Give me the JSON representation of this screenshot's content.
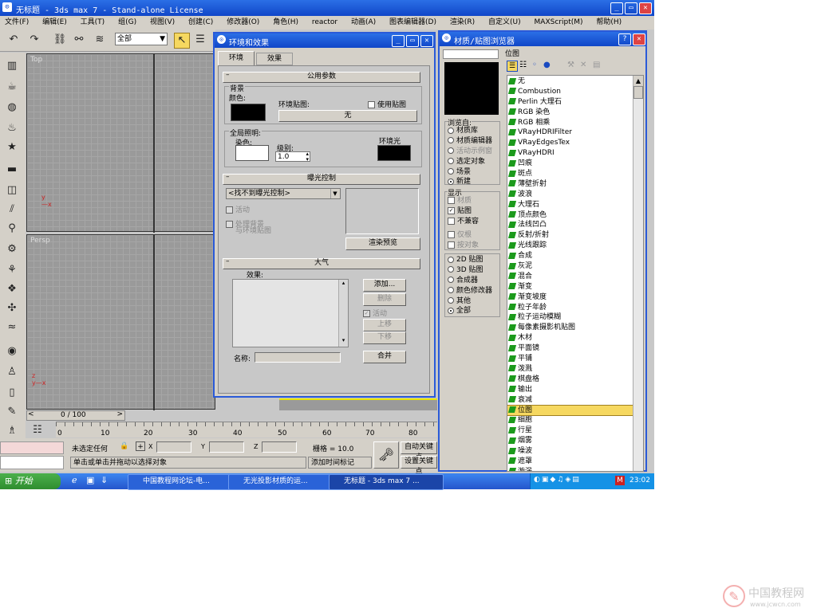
{
  "main_window": {
    "title": "无标题 - 3ds max 7 - Stand-alone License",
    "menu": [
      "文件(F)",
      "编辑(E)",
      "工具(T)",
      "组(G)",
      "视图(V)",
      "创建(C)",
      "修改器(O)",
      "角色(H)",
      "reactor",
      "动画(A)",
      "图表编辑器(D)",
      "渲染(R)",
      "自定义(U)",
      "MAXScript(M)",
      "帮助(H)"
    ],
    "toolbar_dropdown": "全部",
    "viewports": {
      "top_left": "Top",
      "bottom_left": "Persp"
    },
    "time_slider": "0 / 100",
    "ruler_ticks": [
      "0",
      "10",
      "20",
      "30",
      "40",
      "50",
      "60",
      "70",
      "80"
    ],
    "status": {
      "no_selection": "未选定任何",
      "x_label": "X",
      "y_label": "Y",
      "z_label": "Z",
      "grid": "栅格 = 10.0",
      "prompt": "单击或单击并拖动以选择对象",
      "add_time_tag": "添加时间标记",
      "auto_key": "自动关键点",
      "set_key": "设置关键点"
    }
  },
  "env_dialog": {
    "title": "环境和效果",
    "tabs": [
      "环境",
      "效果"
    ],
    "common_params": "公用参数",
    "background": "背景",
    "color_label": "颜色:",
    "env_map_label": "环境贴图:",
    "use_map": "使用贴图",
    "env_map_button": "无",
    "global_lighting": "全局照明:",
    "tint_label": "染色:",
    "level_label": "级别:",
    "level_value": "1.0",
    "ambient_label": "环境光",
    "exposure_control": "曝光控制",
    "exposure_select": "<找不到曝光控制>",
    "active": "活动",
    "process_bg": "处理背景",
    "and_env_maps": "与环境贴图",
    "render_preview": "渲染预览",
    "atmosphere": "大气",
    "effects_label": "效果:",
    "add": "添加...",
    "delete": "删除",
    "active2": "活动",
    "move_up": "上移",
    "move_down": "下移",
    "name_label": "名称:",
    "merge": "合并"
  },
  "mtl_browser": {
    "title": "材质/贴图浏览器",
    "search_value": "位图",
    "browse_from": "浏览自:",
    "browse_options": [
      "材质库",
      "材质编辑器",
      "活动示例窗",
      "选定对象",
      "场景",
      "新建"
    ],
    "browse_selected": 5,
    "show": "显示",
    "show_options": [
      {
        "label": "材质",
        "checked": false,
        "disabled": true
      },
      {
        "label": "贴图",
        "checked": true,
        "disabled": false
      },
      {
        "label": "不兼容",
        "checked": false,
        "disabled": false
      }
    ],
    "root_only": "仅根",
    "by_object": "按对象",
    "map_types": [
      "2D 贴图",
      "3D 贴图",
      "合成器",
      "颜色修改器",
      "其他",
      "全部"
    ],
    "map_selected": 5,
    "items": [
      "无",
      "Combustion",
      "Perlin 大理石",
      "RGB 染色",
      "RGB 相乘",
      "VRayHDRIFilter",
      "VRayEdgesTex",
      "VRayHDRI",
      "凹痕",
      "斑点",
      "薄壁折射",
      "波浪",
      "大理石",
      "顶点颜色",
      "法线凹凸",
      "反射/折射",
      "光线跟踪",
      "合成",
      "灰泥",
      "混合",
      "渐变",
      "渐变坡度",
      "粒子年龄",
      "粒子运动模糊",
      "每像素摄影机贴图",
      "木材",
      "平面镜",
      "平铺",
      "泼溅",
      "棋盘格",
      "输出",
      "衰减",
      "位图",
      "细胞",
      "行星",
      "烟雾",
      "噪波",
      "遮罩",
      "漩涡"
    ],
    "highlighted_item": 32
  },
  "taskbar": {
    "start": "开始",
    "tasks": [
      "中国教程网论坛-电...",
      "无光投影材质的运...",
      "无标题 - 3ds max 7 ..."
    ],
    "clock": "23:02"
  },
  "watermark": {
    "site": "中国教程网",
    "url": "www.jcwcn.com"
  }
}
